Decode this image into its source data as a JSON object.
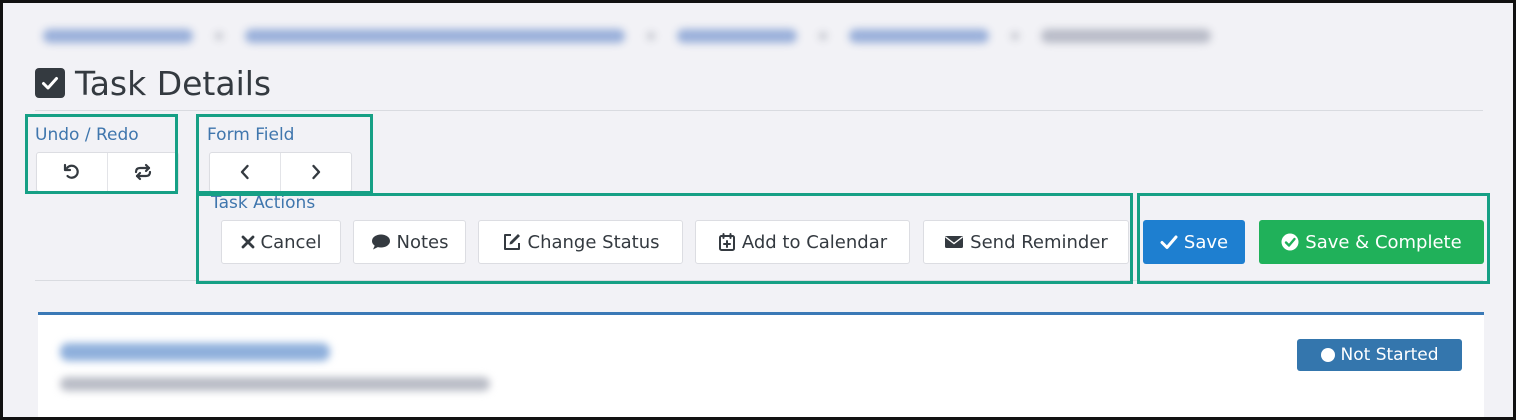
{
  "page": {
    "title": "Task Details",
    "title_icon": "checkbox-icon"
  },
  "undo_redo": {
    "label": "Undo / Redo",
    "undo_icon": "undo-icon",
    "redo_icon": "redo-icon"
  },
  "form_field": {
    "label": "Form Field",
    "prev_icon": "chevron-left-icon",
    "next_icon": "chevron-right-icon"
  },
  "task_actions": {
    "label": "Task Actions",
    "buttons": [
      {
        "label": "Cancel",
        "icon": "close-icon"
      },
      {
        "label": "Notes",
        "icon": "comment-icon"
      },
      {
        "label": "Change Status",
        "icon": "edit-icon"
      },
      {
        "label": "Add to Calendar",
        "icon": "calendar-plus-icon"
      },
      {
        "label": "Send Reminder",
        "icon": "envelope-icon"
      }
    ]
  },
  "primary_actions": {
    "save_label": "Save",
    "save_complete_label": "Save & Complete"
  },
  "status": {
    "label": "Not Started",
    "color": "#3476ad"
  },
  "colors": {
    "highlight": "#16a085",
    "save": "#1e7fd0",
    "save_complete": "#20b15a",
    "label_blue": "#3f76ad"
  }
}
